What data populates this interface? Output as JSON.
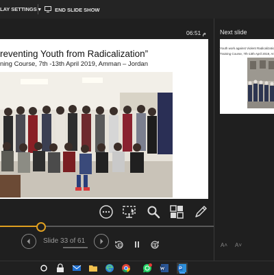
{
  "toolbar": {
    "display_settings_label": "LAY SETTINGS ▾",
    "end_show_label": "END SLIDE SHOW"
  },
  "timer": "06:51 م",
  "slide": {
    "title": "reventing Youth from Radicalization”",
    "subtitle": "ning Course, 7th -13th April 2019, Amman – Jordan"
  },
  "navigation": {
    "counter": "Slide 33 of 61",
    "progress_fraction": 0.19
  },
  "next_slide": {
    "heading": "Next slide",
    "line1": "Youth work against Violent Radicalization",
    "line2": "Training Course, 7th-13th April 2019, Amman"
  },
  "font_controls": {
    "increase": "A˄",
    "decrease": "A˅"
  },
  "colors": {
    "accent": "#e0a020",
    "background": "#1f1f1f",
    "taskbar_highlight": "#4aa3ff"
  },
  "icons": {
    "tools": [
      "more-options-icon",
      "pen-pointer-icon",
      "zoom-icon",
      "see-all-slides-icon",
      "pen-icon"
    ],
    "taskbar": [
      "search-icon",
      "lock-icon",
      "mail-icon",
      "folder-icon",
      "edge-icon",
      "chrome-icon",
      "whatsapp-icon",
      "word-icon",
      "powerpoint-icon"
    ]
  }
}
